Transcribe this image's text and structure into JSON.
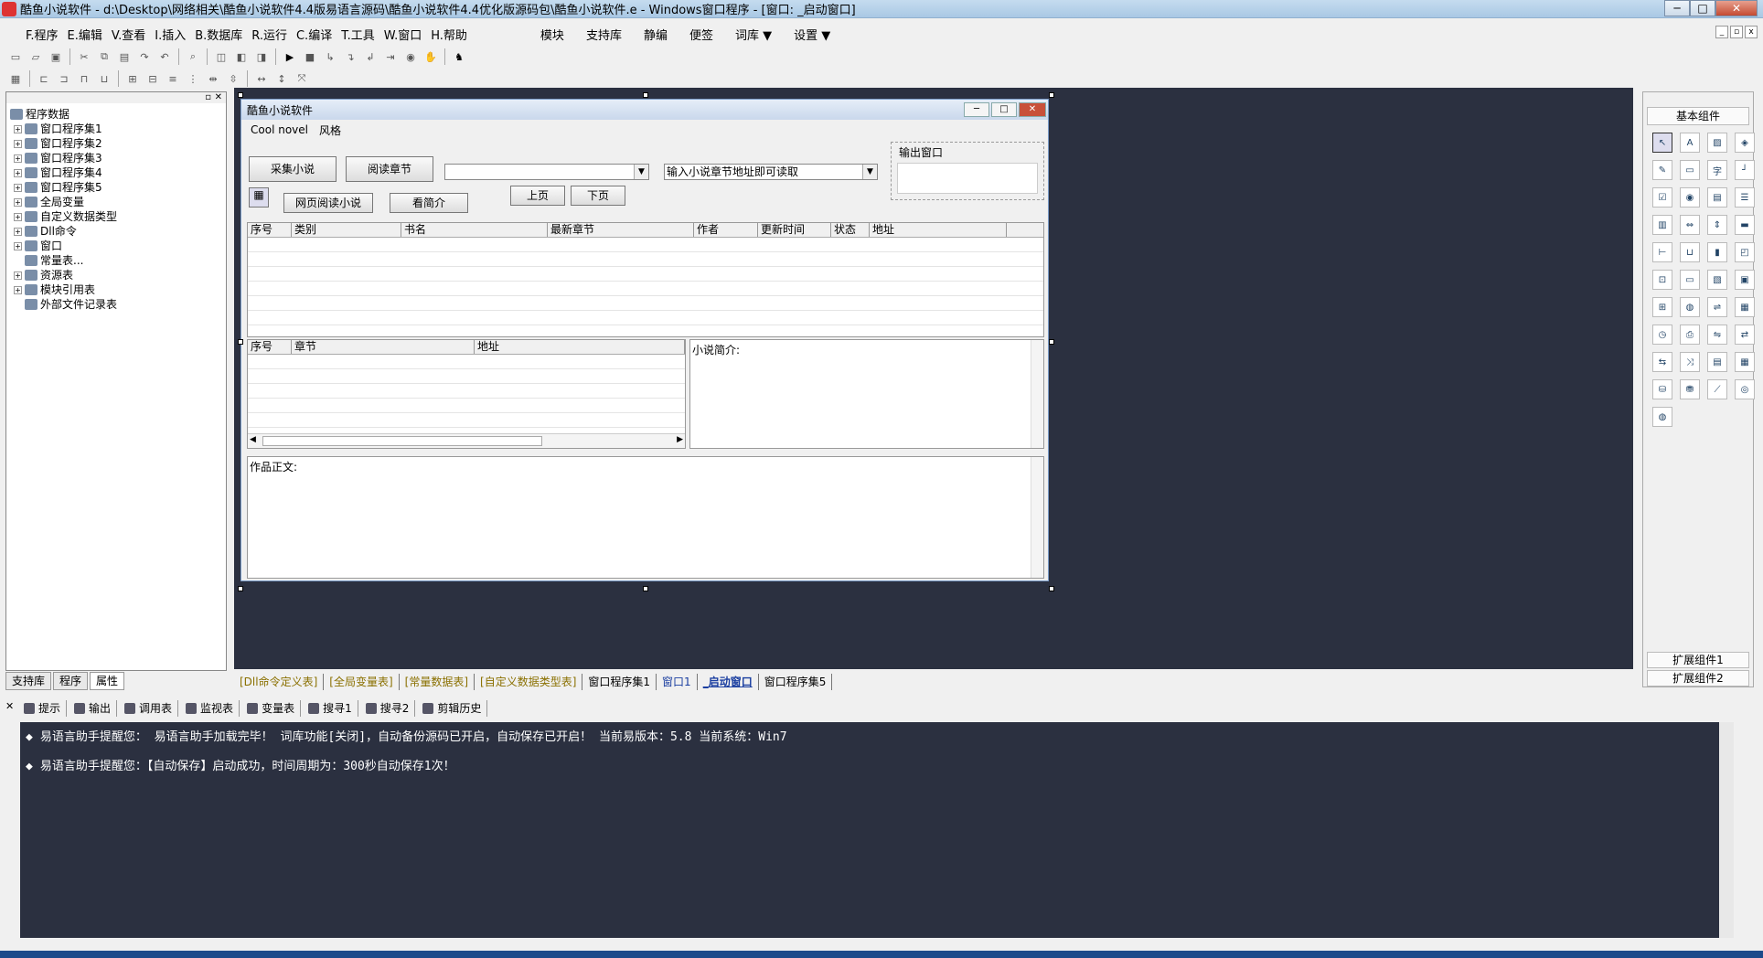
{
  "titlebar": {
    "text": "酷鱼小说软件 - d:\\Desktop\\网络相关\\酷鱼小说软件4.4版易语言源码\\酷鱼小说软件4.4优化版源码包\\酷鱼小说软件.e - Windows窗口程序 - [窗口: _启动窗口]"
  },
  "menu": {
    "items": [
      "F.程序",
      "E.编辑",
      "V.查看",
      "I.插入",
      "B.数据库",
      "R.运行",
      "C.编译",
      "T.工具",
      "W.窗口",
      "H.帮助"
    ],
    "extra": [
      "模块",
      "支持库",
      "静编",
      "便签",
      "词库 ▼",
      "设置 ▼"
    ]
  },
  "tree": {
    "items": [
      "程序数据",
      "窗口程序集1",
      "窗口程序集2",
      "窗口程序集3",
      "窗口程序集4",
      "窗口程序集5",
      "全局变量",
      "自定义数据类型",
      "Dll命令",
      "窗口",
      "常量表...",
      "资源表",
      "模块引用表",
      "外部文件记录表"
    ],
    "tabs": [
      "支持库",
      "程序",
      "属性"
    ]
  },
  "form": {
    "title": "酷鱼小说软件",
    "menu": [
      "Cool novel",
      "风格"
    ],
    "buttons": {
      "collect": "采集小说",
      "read_chapter": "阅读章节",
      "web_read": "网页阅读小说",
      "intro": "看简介",
      "prev": "上页",
      "next": "下页"
    },
    "combo2": "输入小说章节地址即可读取",
    "output_group": "输出窗口",
    "table1_headers": [
      "序号",
      "类别",
      "书名",
      "最新章节",
      "作者",
      "更新时间",
      "状态",
      "地址"
    ],
    "table2_headers": [
      "序号",
      "章节",
      "地址"
    ],
    "intro_label": "小说简介:",
    "body_label": "作品正文:"
  },
  "bottom_tabs": [
    "[Dll命令定义表]",
    "[全局变量表]",
    "[常量数据表]",
    "[自定义数据类型表]",
    "窗口程序集1",
    "窗口1",
    "_启动窗口",
    "窗口程序集5"
  ],
  "right_panel": {
    "header": "基本组件",
    "ext1": "扩展组件1",
    "ext2": "扩展组件2"
  },
  "output_tabs": [
    "提示",
    "输出",
    "调用表",
    "监视表",
    "变量表",
    "搜寻1",
    "搜寻2",
    "剪辑历史"
  ],
  "output_lines": [
    "易语言助手提醒您：  易语言助手加载完毕！  词库功能[关闭]，自动备份源码已开启，自动保存已开启！  当前易版本：5.8  当前系统：Win7",
    "易语言助手提醒您：【自动保存】启动成功，时间周期为：300秒自动保存1次！"
  ]
}
